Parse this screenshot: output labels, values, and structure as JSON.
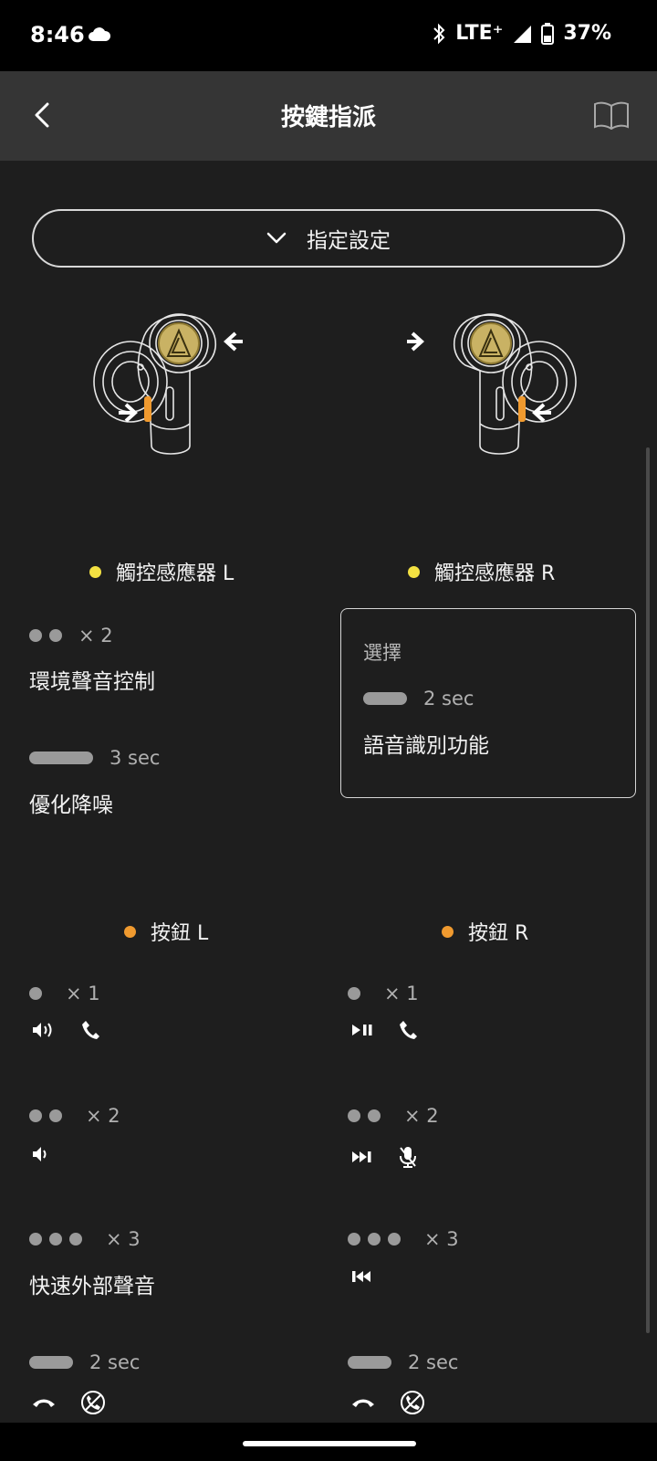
{
  "status": {
    "time": "8:46",
    "network": "LTE⁺",
    "battery": "37%"
  },
  "header": {
    "title": "按鍵指派"
  },
  "preset": {
    "label": "指定設定"
  },
  "touch": {
    "left": {
      "title": "觸控感應器 L",
      "g1": {
        "count": "× 2",
        "action": "環境聲音控制"
      },
      "g2": {
        "duration": "3 sec",
        "action": "優化降噪"
      }
    },
    "right": {
      "title": "觸控感應器 R",
      "select_label": "選擇",
      "g1": {
        "duration": "2 sec",
        "action": "語音識別功能"
      }
    }
  },
  "button": {
    "left": {
      "title": "按鈕 L",
      "g1": {
        "count": "× 1",
        "icons": [
          "volume-up-icon",
          "phone-answer-icon"
        ]
      },
      "g2": {
        "count": "× 2",
        "icons": [
          "volume-down-icon"
        ]
      },
      "g3": {
        "count": "× 3",
        "action": "快速外部聲音"
      },
      "g4": {
        "duration": "2 sec",
        "icons": [
          "phone-hangup-icon",
          "phone-reject-icon"
        ]
      }
    },
    "right": {
      "title": "按鈕 R",
      "g1": {
        "count": "× 1",
        "icons": [
          "play-pause-icon",
          "phone-answer-icon"
        ]
      },
      "g2": {
        "count": "× 2",
        "icons": [
          "next-track-icon",
          "mic-mute-icon"
        ]
      },
      "g3": {
        "count": "× 3",
        "icons": [
          "previous-track-icon"
        ]
      },
      "g4": {
        "duration": "2 sec",
        "icons": [
          "phone-hangup-icon",
          "phone-reject-icon"
        ]
      }
    }
  },
  "colors": {
    "touch_dot": "#f3e142",
    "button_dot": "#f09a2f",
    "background": "#1e1e1e",
    "appbar": "#353535"
  }
}
